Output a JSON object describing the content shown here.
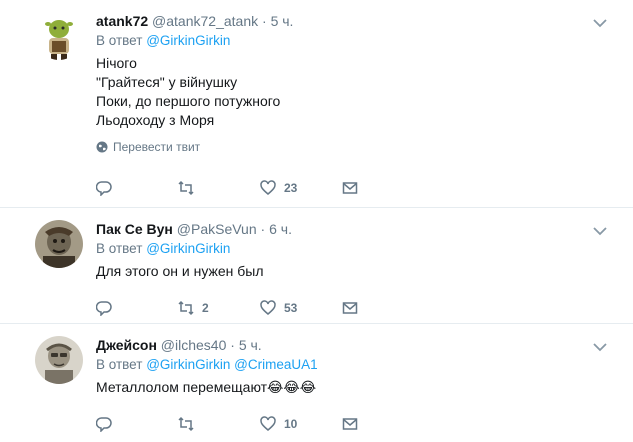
{
  "tweets": [
    {
      "fullname": "atank72",
      "handle": "@atank72_atank",
      "dot": "·",
      "time": "5 ч.",
      "reply_prefix": "В ответ",
      "reply_to": [
        "@GirkinGirkin"
      ],
      "lines": [
        "Нічого",
        "\"Грайтеся\" у війнушку",
        "Поки, до першого потужного",
        "Льодоходу з Моря"
      ],
      "translate": "Перевести твит",
      "reply_count": "",
      "retweet_count": "",
      "like_count": "23"
    },
    {
      "fullname": "Пак Се Вун",
      "handle": "@PakSeVun",
      "dot": "·",
      "time": "6 ч.",
      "reply_prefix": "В ответ",
      "reply_to": [
        "@GirkinGirkin"
      ],
      "lines": [
        "Для этого он и нужен был"
      ],
      "reply_count": "",
      "retweet_count": "2",
      "like_count": "53"
    },
    {
      "fullname": "Джейсон",
      "handle": "@ilches40",
      "dot": "·",
      "time": "5 ч.",
      "reply_prefix": "В ответ",
      "reply_to": [
        "@GirkinGirkin",
        "@CrimeaUA1"
      ],
      "lines": [
        "Металлолом перемещают"
      ],
      "emoji": "😂😂😂",
      "reply_count": "",
      "retweet_count": "",
      "like_count": "10"
    }
  ],
  "icons": {
    "reply": "reply-icon",
    "retweet": "retweet-icon",
    "like": "heart-icon",
    "dm": "envelope-icon",
    "caret": "chevron-down-icon",
    "globe": "globe-icon"
  },
  "colors": {
    "link": "#1da1f2",
    "muted": "#657786",
    "text": "#14171a",
    "border": "#e6ecf0"
  }
}
